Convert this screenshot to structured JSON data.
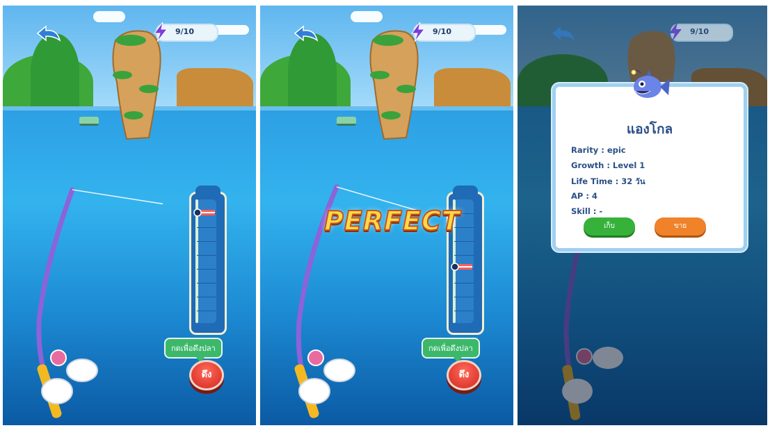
{
  "energy": {
    "value": "9/10"
  },
  "panel1": {
    "hint": "กดเพื่อดึงปลา",
    "pull_button": "ดึง",
    "meter_fill": 0.08
  },
  "panel2": {
    "feedback": "PERFECT",
    "hint": "กดเพื่อดึงปลา",
    "pull_button": "ดึง",
    "meter_fill": 0.55
  },
  "catch_dialog": {
    "fish_name": "แองโกล",
    "rarity": "Rarity : epic",
    "growth": "Growth : Level 1",
    "lifetime": "Life Time : 32 วัน",
    "ap": "AP : 4",
    "skill": "Skill : -",
    "keep_button": "เก็บ",
    "sell_button": "ขาย"
  },
  "colors": {
    "sea": "#2d9fe4",
    "keep": "#36b23b",
    "sell": "#f0822a",
    "pull": "#d3261e",
    "perfect": "#ffd84a"
  }
}
